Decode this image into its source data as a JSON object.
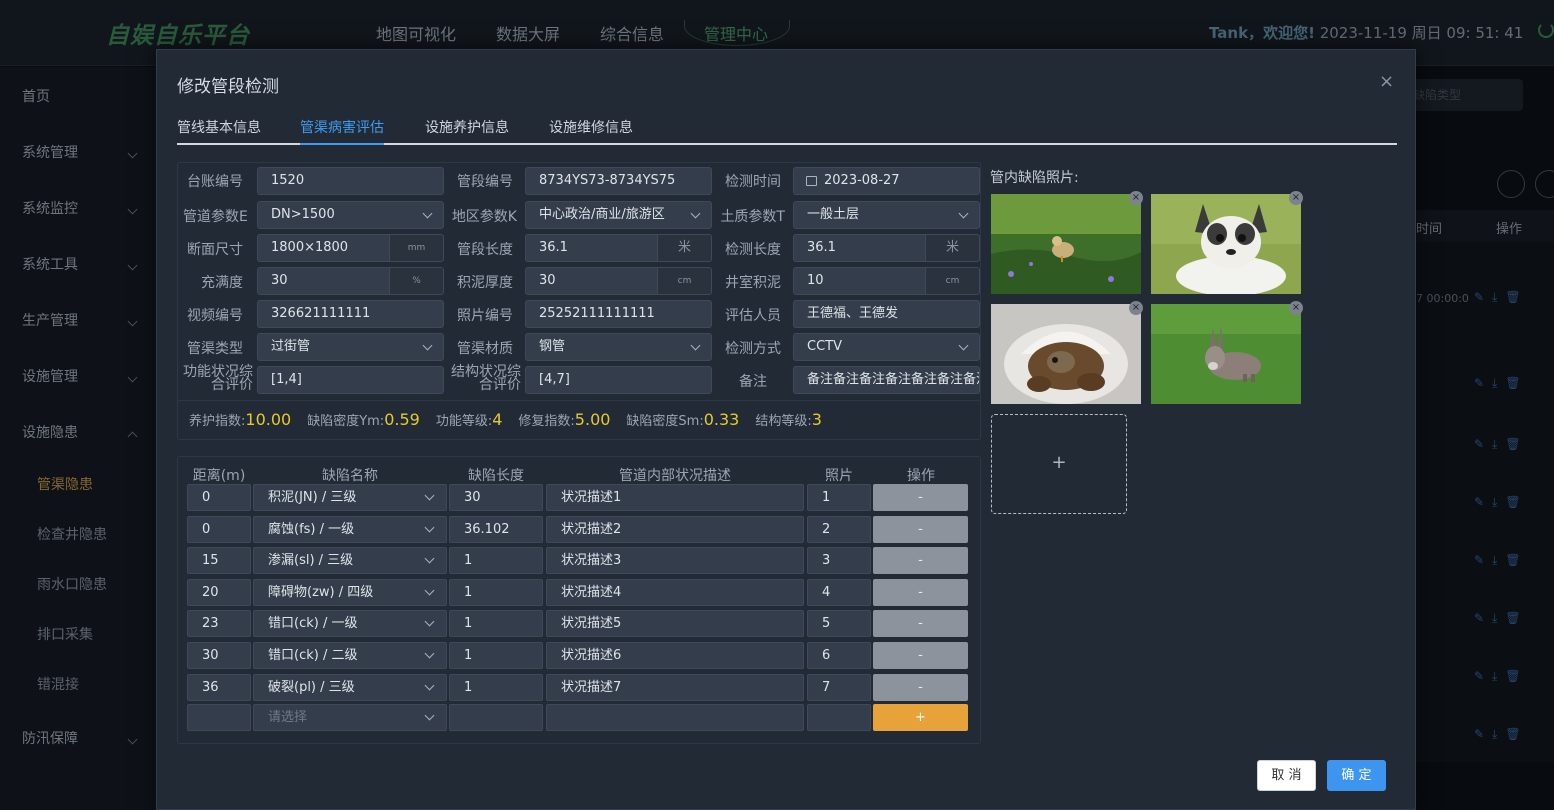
{
  "app": {
    "logo": "自娱自乐平台",
    "nav": [
      "地图可视化",
      "数据大屏",
      "综合信息",
      "管理中心"
    ],
    "welcome_user": "Tank，欢迎您!",
    "datetime": "2023-11-19 周日 09: 51: 41"
  },
  "sidebar": {
    "items": [
      {
        "label": "首页"
      },
      {
        "label": "系统管理"
      },
      {
        "label": "系统监控"
      },
      {
        "label": "系统工具"
      },
      {
        "label": "生产管理"
      },
      {
        "label": "设施管理"
      },
      {
        "label": "设施隐患"
      },
      {
        "label": "管渠隐患"
      },
      {
        "label": "检查井隐患"
      },
      {
        "label": "雨水口隐患"
      },
      {
        "label": "排口采集"
      },
      {
        "label": "错混接"
      },
      {
        "label": "防汛保障"
      }
    ]
  },
  "background": {
    "search_placeholder": "缺陷类型",
    "col_time": "时间",
    "col_ops": "操作",
    "row_time": "7 00:00:0"
  },
  "modal": {
    "title": "修改管段检测",
    "close": "×",
    "tabs": [
      "管线基本信息",
      "管渠病害评估",
      "设施养护信息",
      "设施维修信息"
    ],
    "fields": {
      "ledger_no_label": "台账编号",
      "ledger_no": "1520",
      "segment_no_label": "管段编号",
      "segment_no": "8734YS73-8734YS75",
      "detect_time_label": "检测时间",
      "detect_time": "2023-08-27",
      "pipe_param_label": "管道参数E",
      "pipe_param": "DN>1500",
      "area_param_label": "地区参数K",
      "area_param": "中心政治/商业/旅游区",
      "soil_param_label": "土质参数T",
      "soil_param": "一般土层",
      "section_label": "断面尺寸",
      "section": "1800×1800",
      "section_unit": "mm",
      "seg_len_label": "管段长度",
      "seg_len": "36.1",
      "seg_len_unit": "米",
      "det_len_label": "检测长度",
      "det_len": "36.1",
      "det_len_unit": "米",
      "fill_label": "充满度",
      "fill": "30",
      "fill_unit": "%",
      "silt_label": "积泥厚度",
      "silt": "30",
      "silt_unit": "cm",
      "well_silt_label": "井室积泥",
      "well_silt": "10",
      "well_silt_unit": "cm",
      "video_no_label": "视频编号",
      "video_no": "326621111111",
      "photo_no_label": "照片编号",
      "photo_no": "25252111111111",
      "evaluator_label": "评估人员",
      "evaluator": "王德福、王德发",
      "channel_type_label": "管渠类型",
      "channel_type": "过街管",
      "material_label": "管渠材质",
      "material": "钢管",
      "method_label": "检测方式",
      "method": "CCTV",
      "func_eval_label_1": "功能状况综",
      "func_eval_label_2": "合评价",
      "func_eval": "[1,4]",
      "struct_eval_label_1": "结构状况综",
      "struct_eval_label_2": "合评价",
      "struct_eval": "[4,7]",
      "remark_label": "备注",
      "remark": "备注备注备注备注备注备注备注"
    },
    "stats": {
      "maint_idx_label": "养护指数:",
      "maint_idx": "10.00",
      "ym_label": "缺陷密度Ym:",
      "ym": "0.59",
      "func_grade_label": "功能等级:",
      "func_grade": "4",
      "repair_idx_label": "修复指数:",
      "repair_idx": "5.00",
      "sm_label": "缺陷密度Sm:",
      "sm": "0.33",
      "struct_grade_label": "结构等级:",
      "struct_grade": "3"
    },
    "defects": {
      "headers": [
        "距离(m)",
        "缺陷名称",
        "缺陷长度",
        "管道内部状况描述",
        "照片",
        "操作"
      ],
      "rows": [
        {
          "dist": "0",
          "name": "积泥(JN) / 三级",
          "len": "30",
          "desc": "状况描述1",
          "photo": "1"
        },
        {
          "dist": "0",
          "name": "腐蚀(fs) / 一级",
          "len": "36.102",
          "desc": "状况描述2",
          "photo": "2"
        },
        {
          "dist": "15",
          "name": "渗漏(sl) / 三级",
          "len": "1",
          "desc": "状况描述3",
          "photo": "3"
        },
        {
          "dist": "20",
          "name": "障碍物(zw) / 四级",
          "len": "1",
          "desc": "状况描述4",
          "photo": "4"
        },
        {
          "dist": "23",
          "name": "错口(ck) / 一级",
          "len": "1",
          "desc": "状况描述5",
          "photo": "5"
        },
        {
          "dist": "30",
          "name": "错口(ck) / 二级",
          "len": "1",
          "desc": "状况描述6",
          "photo": "6"
        },
        {
          "dist": "36",
          "name": "破裂(pl) / 三级",
          "len": "1",
          "desc": "状况描述7",
          "photo": "7"
        }
      ],
      "new_placeholder": "请选择",
      "minus": "-",
      "plus": "+"
    },
    "photos_label": "管内缺陷照片:",
    "photo_remove": "×",
    "upload_plus": "+",
    "cancel": "取 消",
    "ok": "确 定"
  }
}
